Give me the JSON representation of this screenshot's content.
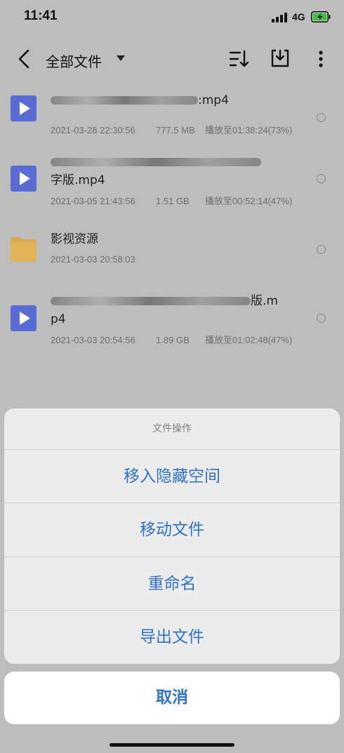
{
  "status_bar": {
    "time": "11:41",
    "network": "4G"
  },
  "header": {
    "title": "全部文件",
    "icons": [
      "back-icon",
      "chevron-down-icon",
      "sort-icon",
      "import-icon",
      "more-icon"
    ]
  },
  "files": [
    {
      "name_visible": ":mp4",
      "date": "2021-03-28 22:30:56",
      "size": "777.5 MB",
      "progress": "播放至01:38:24(73%)",
      "type": "video"
    },
    {
      "name_visible_line2": "字版.mp4",
      "date": "2021-03-05 21:43:56",
      "size": "1.51 GB",
      "progress": "播放至00:52:14(47%)",
      "type": "video"
    },
    {
      "name_visible": "影视资源",
      "date": "2021-03-03 20:58:03",
      "type": "folder"
    },
    {
      "name_visible": "版.m",
      "name_visible_line2": "p4",
      "date": "2021-03-03 20:54:56",
      "size": "1.89 GB",
      "progress": "播放至01:02:48(47%)",
      "type": "video"
    }
  ],
  "action_sheet": {
    "title": "文件操作",
    "options": [
      "移入隐藏空间",
      "移动文件",
      "重命名",
      "导出文件"
    ],
    "cancel": "取消"
  },
  "colors": {
    "accent": "#2f73c4",
    "video_icon": "#5a6bd6",
    "folder_icon": "#d9a84a"
  }
}
